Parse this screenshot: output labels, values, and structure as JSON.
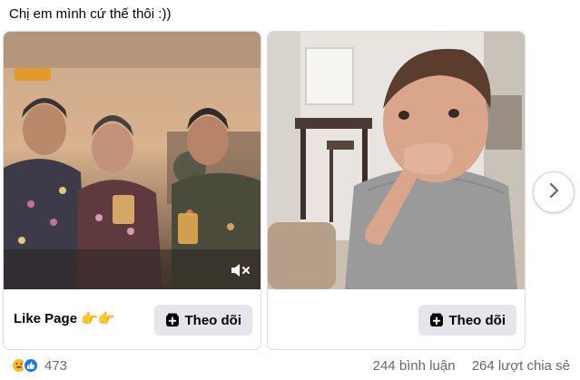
{
  "post": {
    "text": "Chị em mình cứ thế thôi :))"
  },
  "cards": [
    {
      "footer_label": "Like Page 👉👉",
      "follow_label": "Theo dõi"
    },
    {
      "footer_label": "",
      "follow_label": "Theo dõi"
    }
  ],
  "reactions": {
    "count": "473",
    "icons": [
      "haha-icon",
      "like-icon"
    ]
  },
  "stats": {
    "comments": "244 bình luận",
    "shares": "264 lượt chia sẻ"
  },
  "colors": {
    "button_bg": "#e4e6eb",
    "meta_text": "#65676b",
    "like_blue": "#1877f2",
    "haha_yellow": "#f7b928"
  }
}
